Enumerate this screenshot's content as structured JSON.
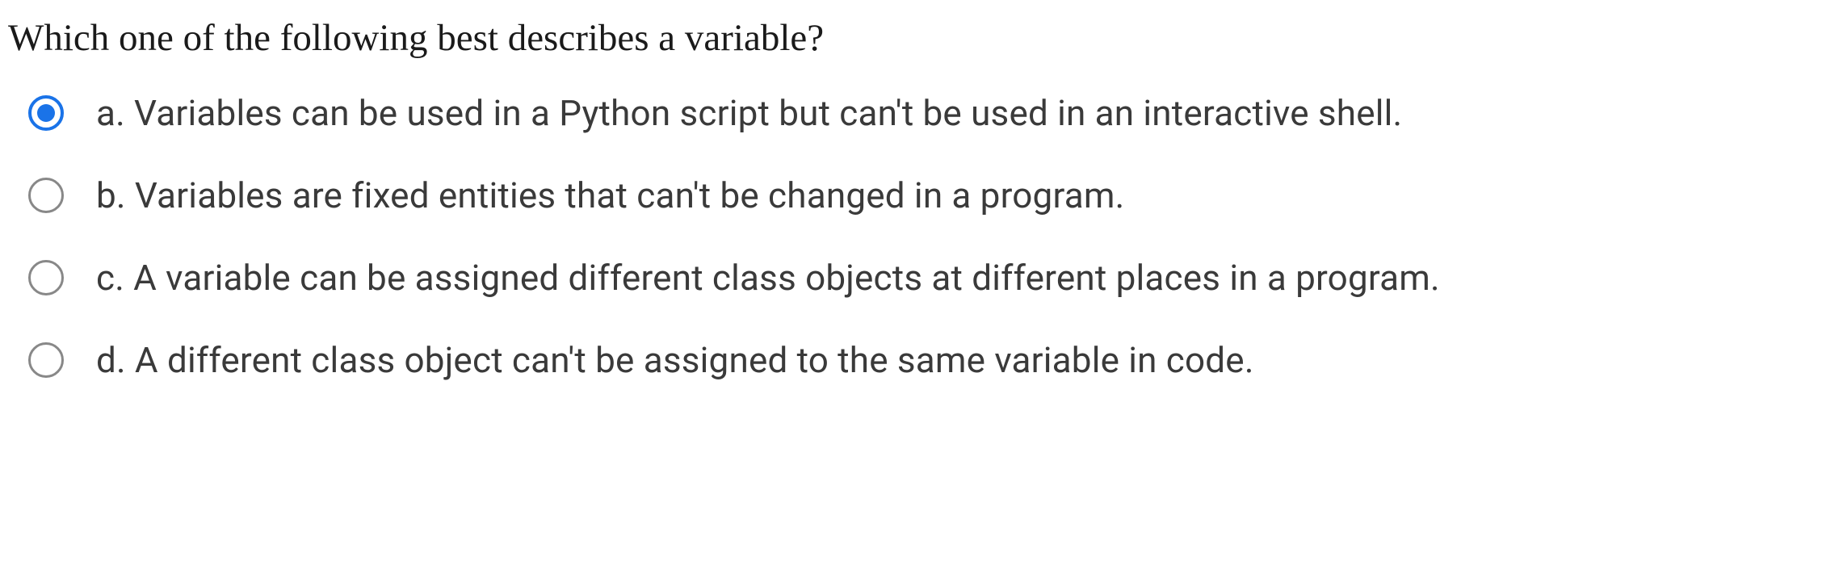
{
  "question": "Which one of the following best describes a variable?",
  "options": [
    {
      "label": "a. Variables can be used in a Python script but can't be used in an interactive shell.",
      "selected": true
    },
    {
      "label": "b. Variables are fixed entities that can't be changed in a program.",
      "selected": false
    },
    {
      "label": "c. A variable can be assigned different class objects at different places in a program.",
      "selected": false
    },
    {
      "label": "d. A different class object can't be assigned to the same variable in code.",
      "selected": false
    }
  ]
}
